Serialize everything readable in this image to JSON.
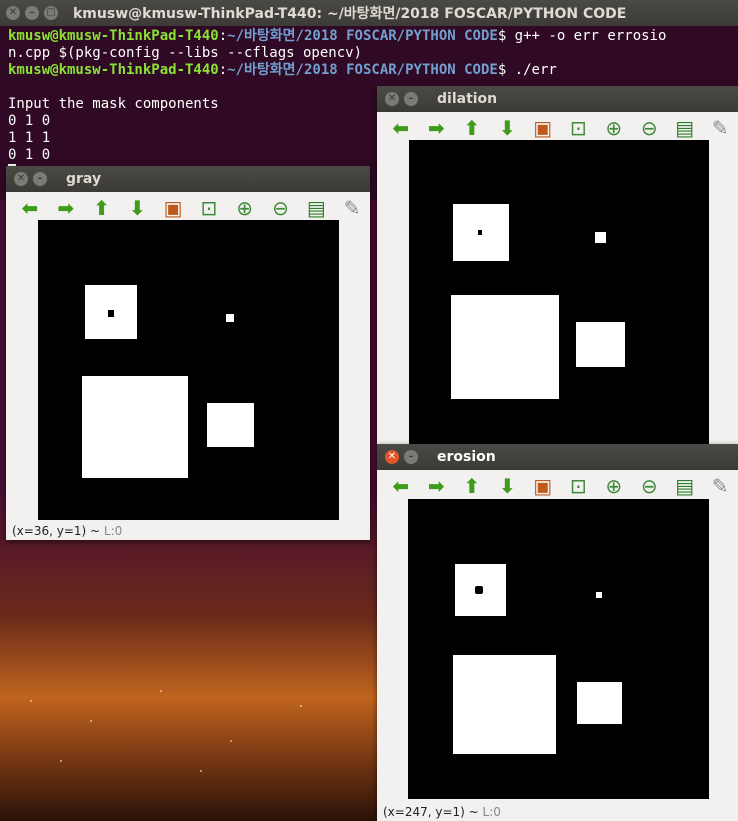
{
  "terminal": {
    "title": "kmusw@kmusw-ThinkPad-T440: ~/바탕화면/2018 FOSCAR/PYTHON CODE",
    "prompt_user": "kmusw@kmusw-ThinkPad-T440",
    "prompt_path": "~/바탕화면/2018 FOSCAR/PYTHON CODE",
    "cmd1_a": "$ g++ -o err errosio",
    "cmd1_b": "n.cpp $(pkg-config --libs --cflags opencv)",
    "cmd2": "$ ./err",
    "out1": "Input the mask components",
    "out2": "0 1 0",
    "out3": "1 1 1",
    "out4": "0 1 0"
  },
  "windows": {
    "gray": {
      "title": "gray",
      "status": "(x=36, y=1) ~ ",
      "status_l": "L:0"
    },
    "dilation": {
      "title": "dilation"
    },
    "erosion": {
      "title": "erosion",
      "status": "(x=247, y=1) ~ ",
      "status_l": "L:0"
    }
  },
  "toolbar_icons": [
    "arrow-left-icon",
    "arrow-right-icon",
    "arrow-up-icon",
    "arrow-down-icon",
    "picture-icon",
    "zoom-fit-icon",
    "zoom-in-icon",
    "zoom-out-icon",
    "save-icon",
    "brush-icon"
  ],
  "colors": {
    "terminal_bg": "#300a24",
    "prompt_user": "#8ae234",
    "prompt_path": "#729fcf",
    "close_button": "#e2552b"
  }
}
